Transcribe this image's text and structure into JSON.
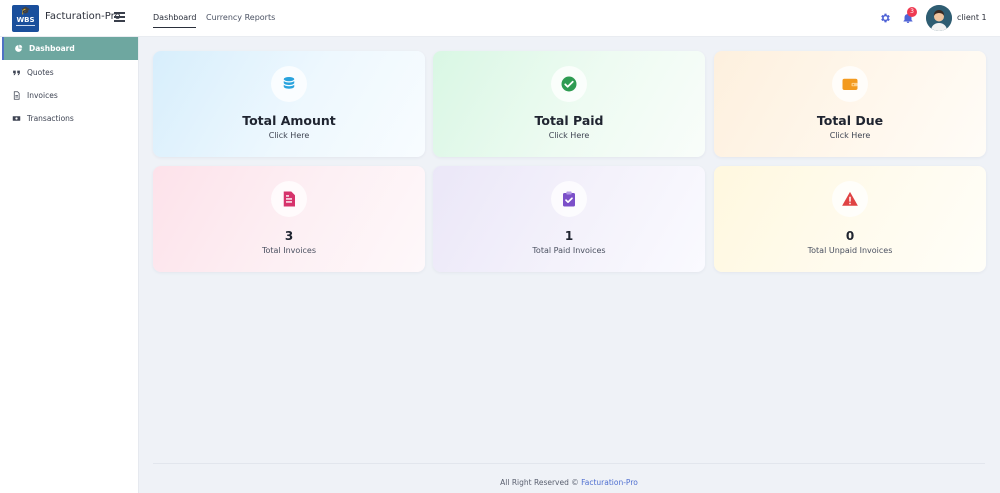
{
  "header": {
    "logo_text": "WBS",
    "brand": "Facturation-Pro",
    "tabs": [
      {
        "label": "Dashboard",
        "active": true
      },
      {
        "label": "Currency Reports",
        "active": false
      }
    ],
    "notification_count": "3",
    "username": "client 1",
    "icons": [
      "hamburger-icon",
      "gear-icon",
      "bell-icon"
    ]
  },
  "sidebar": {
    "items": [
      {
        "label": "Dashboard",
        "icon": "dashboard-icon",
        "active": true
      },
      {
        "label": "Quotes",
        "icon": "quote-icon",
        "active": false
      },
      {
        "label": "Invoices",
        "icon": "document-icon",
        "active": false
      },
      {
        "label": "Transactions",
        "icon": "money-icon",
        "active": false
      }
    ]
  },
  "cards": [
    {
      "title": "Total Amount",
      "subtitle": "Click Here",
      "icon": "coins-icon",
      "color": "#29a3dd"
    },
    {
      "title": "Total Paid",
      "subtitle": "Click Here",
      "icon": "check-circle-icon",
      "color": "#2e9b52"
    },
    {
      "title": "Total Due",
      "subtitle": "Click Here",
      "icon": "wallet-icon",
      "color": "#f39a1e"
    }
  ],
  "stats": [
    {
      "value": "3",
      "label": "Total Invoices",
      "icon": "invoice-icon",
      "color": "#d6336c"
    },
    {
      "value": "1",
      "label": "Total Paid Invoices",
      "icon": "clipboard-check-icon",
      "color": "#7b4fc9"
    },
    {
      "value": "0",
      "label": "Total Unpaid Invoices",
      "icon": "warning-icon",
      "color": "#e04343"
    }
  ],
  "footer": {
    "text": "All Right Reserved ©",
    "link": "Facturation-Pro"
  }
}
